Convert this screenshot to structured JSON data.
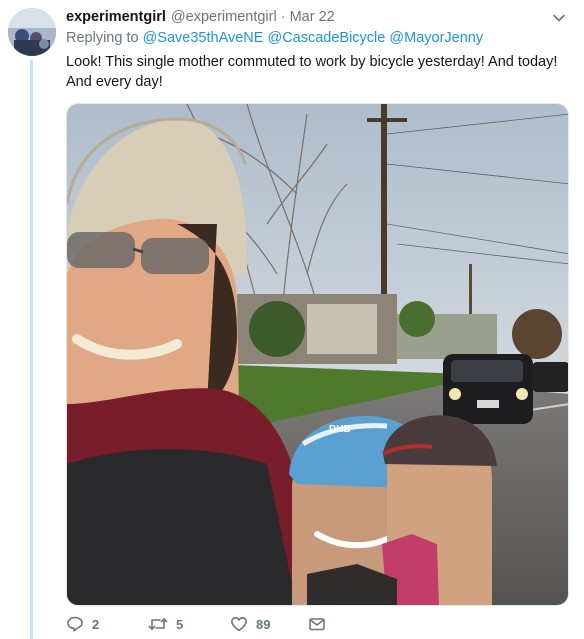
{
  "tweet": {
    "display_name": "experimentgirl",
    "handle": "@experimentgirl",
    "separator": "·",
    "timestamp": "Mar 22",
    "replying_prefix": "Replying to",
    "mentions": [
      "@Save35thAveNE",
      "@CascadeBicycle",
      "@MayorJenny"
    ],
    "text": "Look! This single mother commuted to work by bicycle yesterday! And today! And every day!",
    "photo_text": "DHB"
  },
  "actions": {
    "reply_count": "2",
    "retweet_count": "5",
    "like_count": "89"
  },
  "icons": {
    "caret": "chevron-down-icon",
    "reply": "reply-bubble-icon",
    "retweet": "retweet-icon",
    "like": "heart-icon",
    "message": "envelope-icon"
  },
  "colors": {
    "link": "#1b95e0",
    "muted": "#657786",
    "thread_line": "#c4e5f7"
  }
}
